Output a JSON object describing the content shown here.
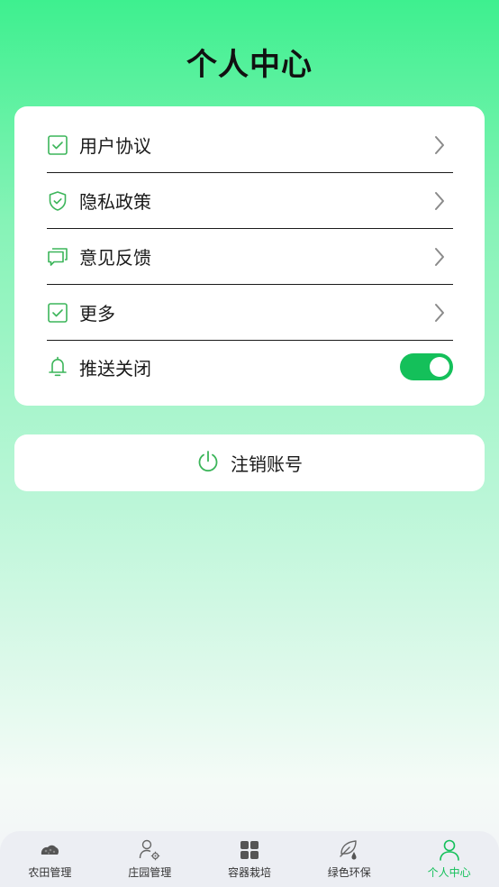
{
  "header": {
    "title": "个人中心"
  },
  "menu": {
    "items": [
      {
        "label": "用户协议",
        "icon": "checkbox-icon"
      },
      {
        "label": "隐私政策",
        "icon": "shield-check-icon"
      },
      {
        "label": "意见反馈",
        "icon": "chat-bubbles-icon"
      },
      {
        "label": "更多",
        "icon": "checkbox-icon"
      }
    ],
    "push": {
      "label": "推送关闭",
      "icon": "bell-icon",
      "enabled": true
    }
  },
  "logout": {
    "label": "注销账号",
    "icon": "power-icon"
  },
  "tabbar": {
    "items": [
      {
        "label": "农田管理",
        "icon": "soil-icon"
      },
      {
        "label": "庄园管理",
        "icon": "user-gear-icon"
      },
      {
        "label": "容器栽培",
        "icon": "grid-icon"
      },
      {
        "label": "绿色环保",
        "icon": "leaf-drop-icon"
      },
      {
        "label": "个人中心",
        "icon": "user-icon",
        "active": true
      }
    ]
  },
  "colors": {
    "accent": "#14c05a",
    "icon_green": "#3cb55a"
  }
}
